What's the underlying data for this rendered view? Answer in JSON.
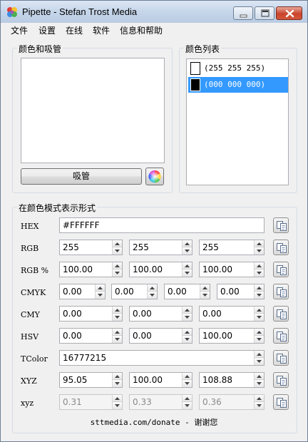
{
  "window": {
    "title": "Pipette - Stefan Trost Media",
    "app_icon": "color-drops-icon"
  },
  "menu": [
    "文件",
    "设置",
    "在线",
    "软件",
    "信息和帮助"
  ],
  "picker": {
    "group_label": "颜色和吸管",
    "preview_color": "#ffffff",
    "pick_button": "吸管",
    "wheel_icon": "color-wheel-icon"
  },
  "color_list": {
    "group_label": "颜色列表",
    "items": [
      {
        "swatch": "#ffffff",
        "label": "(255 255 255)",
        "selected": false
      },
      {
        "swatch": "#000000",
        "label": "(000 000 000)",
        "selected": true
      }
    ],
    "selection_color": "#3399ff"
  },
  "models": {
    "group_label": "在颜色模式表示形式",
    "rows": [
      {
        "label": "HEX",
        "values": [
          "#FFFFFF"
        ],
        "spin": false
      },
      {
        "label": "RGB",
        "values": [
          "255",
          "255",
          "255"
        ],
        "spin": true
      },
      {
        "label": "RGB %",
        "values": [
          "100.00",
          "100.00",
          "100.00"
        ],
        "spin": true
      },
      {
        "label": "CMYK",
        "values": [
          "0.00",
          "0.00",
          "0.00",
          "0.00"
        ],
        "spin": true
      },
      {
        "label": "CMY",
        "values": [
          "0.00",
          "0.00",
          "0.00"
        ],
        "spin": true
      },
      {
        "label": "HSV",
        "values": [
          "0.00",
          "0.00",
          "100.00"
        ],
        "spin": true
      },
      {
        "label": "TColor",
        "values": [
          "16777215"
        ],
        "spin": true
      },
      {
        "label": "XYZ",
        "values": [
          "95.05",
          "100.00",
          "108.88"
        ],
        "spin": true
      },
      {
        "label": "xyz",
        "values": [
          "0.31",
          "0.33",
          "0.36"
        ],
        "spin": true,
        "disabled": true
      }
    ],
    "copy_icon": "copy-icon"
  },
  "footer": "sttmedia.com/donate - 谢谢您"
}
